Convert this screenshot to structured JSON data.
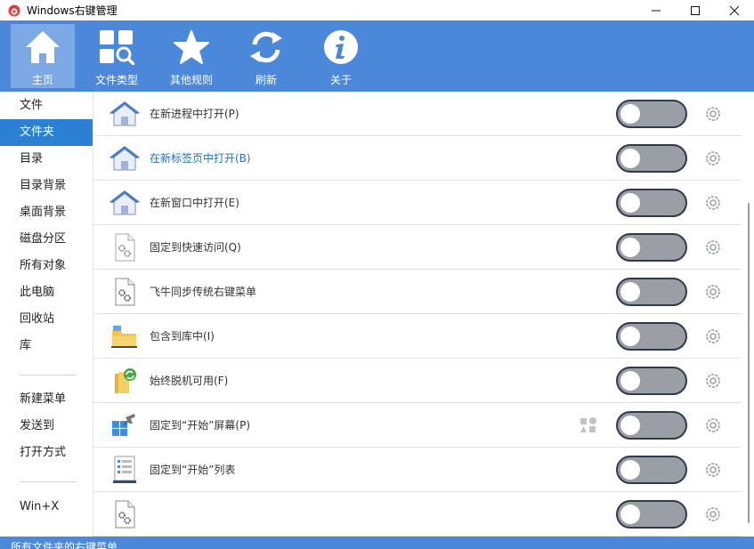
{
  "window": {
    "title": "Windows右键管理",
    "minimize_icon": "minimize-icon",
    "maximize_icon": "maximize-icon",
    "close_icon": "close-icon"
  },
  "toolbar": {
    "items": [
      {
        "label": "主页",
        "icon": "home-icon",
        "active": true
      },
      {
        "label": "文件类型",
        "icon": "file-type-icon",
        "active": false
      },
      {
        "label": "其他规则",
        "icon": "star-icon",
        "active": false
      },
      {
        "label": "刷新",
        "icon": "refresh-icon",
        "active": false
      },
      {
        "label": "关于",
        "icon": "info-icon",
        "active": false
      }
    ],
    "color": "#4b88d9"
  },
  "sidebar": {
    "items": [
      {
        "label": "文件",
        "active": false
      },
      {
        "label": "文件夹",
        "active": true
      },
      {
        "label": "目录",
        "active": false
      },
      {
        "label": "目录背景",
        "active": false
      },
      {
        "label": "桌面背景",
        "active": false
      },
      {
        "label": "磁盘分区",
        "active": false
      },
      {
        "label": "所有对象",
        "active": false
      },
      {
        "label": "此电脑",
        "active": false
      },
      {
        "label": "回收站",
        "active": false
      },
      {
        "label": "库",
        "active": false
      },
      {
        "label": "新建菜单",
        "active": false
      },
      {
        "label": "发送到",
        "active": false
      },
      {
        "label": "打开方式",
        "active": false
      },
      {
        "label": "Win+X",
        "active": false
      }
    ],
    "active_color": "#2b80d3"
  },
  "list": {
    "rows": [
      {
        "label": "在新进程中打开(P)",
        "icon": "house-icon",
        "enabled": false,
        "highlight": false
      },
      {
        "label": "在新标签页中打开(B)",
        "icon": "house-icon",
        "enabled": false,
        "highlight": true
      },
      {
        "label": "在新窗口中打开(E)",
        "icon": "house-icon",
        "enabled": false,
        "highlight": false
      },
      {
        "label": "固定到快速访问(Q)",
        "icon": "settings-file-icon",
        "enabled": false,
        "highlight": false
      },
      {
        "label": "飞牛同步传统右键菜单",
        "icon": "settings-file-icon",
        "enabled": false,
        "highlight": false
      },
      {
        "label": "包含到库中(I)",
        "icon": "library-folder-icon",
        "enabled": false,
        "highlight": false
      },
      {
        "label": "始终脱机可用(F)",
        "icon": "sync-folder-icon",
        "enabled": false,
        "highlight": false
      },
      {
        "label": "固定到“开始”屏幕(P)",
        "icon": "pin-start-icon",
        "enabled": false,
        "highlight": false,
        "extra_icon": "shapes-icon"
      },
      {
        "label": "固定到“开始”列表",
        "icon": "start-list-icon",
        "enabled": false,
        "highlight": false
      },
      {
        "label": "",
        "icon": "settings-file-icon",
        "enabled": false,
        "highlight": false
      }
    ],
    "gear_icon": "gear-icon"
  },
  "status": {
    "text": "所有文件夹的右键菜单"
  }
}
